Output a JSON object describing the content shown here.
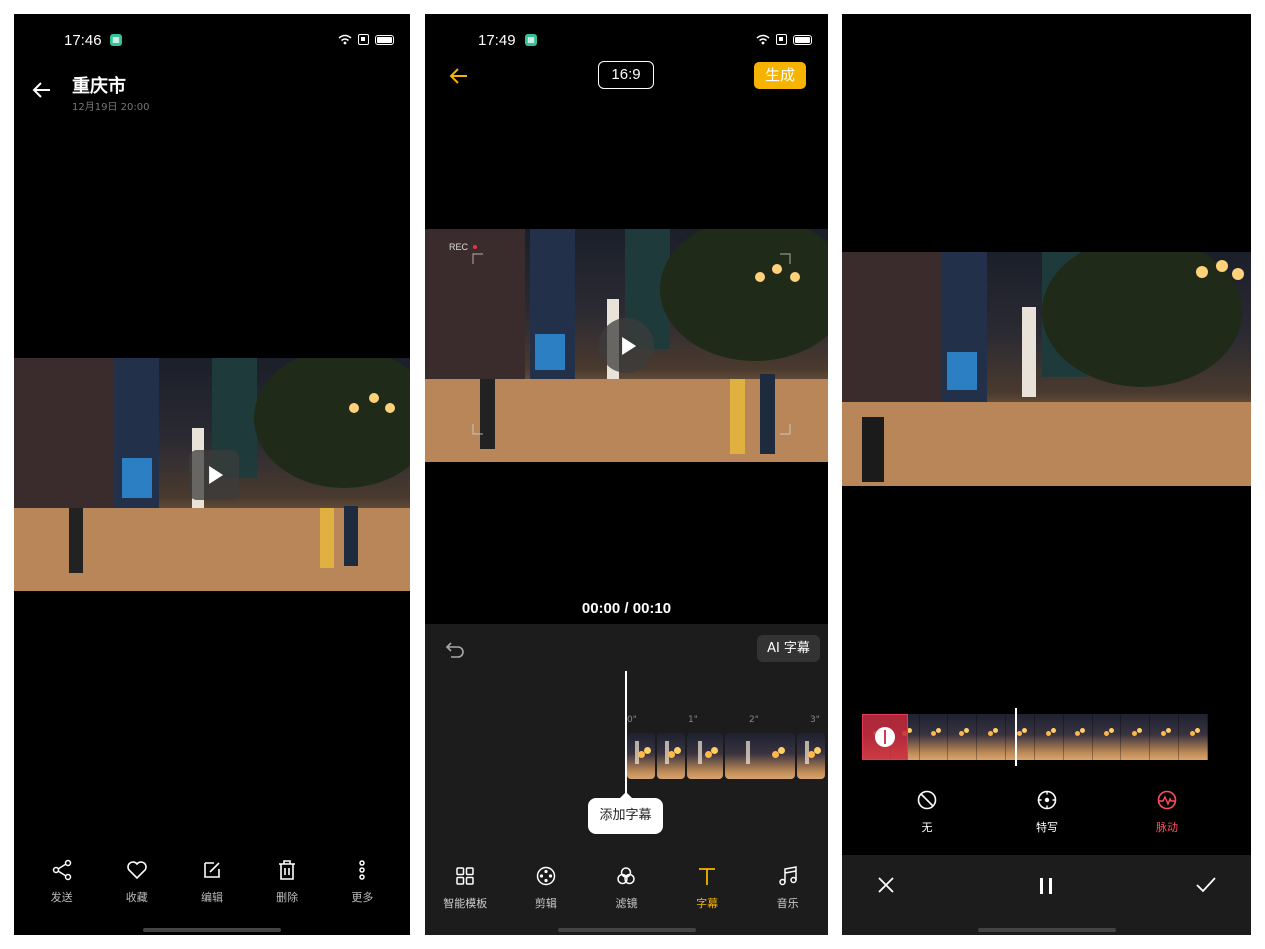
{
  "screens": [
    {
      "status": {
        "time": "17:46"
      },
      "header": {
        "title": "重庆市",
        "subtitle": "12月19日 20:00"
      },
      "toolbar": [
        {
          "label": "发送",
          "icon": "share-icon"
        },
        {
          "label": "收藏",
          "icon": "heart-icon"
        },
        {
          "label": "编辑",
          "icon": "edit-icon"
        },
        {
          "label": "删除",
          "icon": "trash-icon"
        },
        {
          "label": "更多",
          "icon": "more-icon"
        }
      ]
    },
    {
      "status": {
        "time": "17:49"
      },
      "header": {
        "ratio": "16:9",
        "generate": "生成"
      },
      "video": {
        "rec": "REC"
      },
      "timecode": "00:00 / 00:10",
      "editor": {
        "ai_caption": "AI 字幕",
        "ticks": [
          "0\"",
          "1\"",
          "2\"",
          "3\""
        ],
        "tooltip": "添加字幕"
      },
      "toolbar": [
        {
          "label": "智能模板",
          "icon": "grid-icon",
          "active": false
        },
        {
          "label": "剪辑",
          "icon": "film-reel-icon",
          "active": false
        },
        {
          "label": "滤镜",
          "icon": "filter-icon",
          "active": false
        },
        {
          "label": "字幕",
          "icon": "text-icon",
          "active": true
        },
        {
          "label": "音乐",
          "icon": "music-icon",
          "active": false
        }
      ]
    },
    {
      "options": [
        {
          "label": "无",
          "icon": "none-icon",
          "active": false
        },
        {
          "label": "特写",
          "icon": "focus-icon",
          "active": false
        },
        {
          "label": "脉动",
          "icon": "pulse-icon",
          "active": true
        }
      ]
    }
  ],
  "colors": {
    "accent_yellow": "#f6b400",
    "accent_red": "#ff4d5e"
  }
}
